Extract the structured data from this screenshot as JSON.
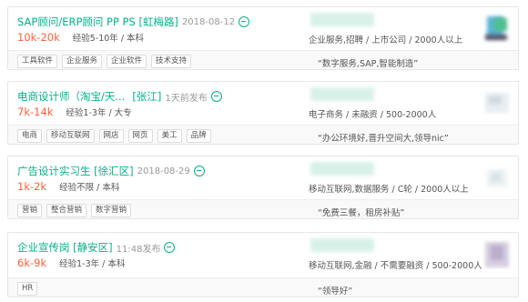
{
  "colors": {
    "accent": "#00b38a",
    "salary": "#fd5f39",
    "muted": "#999999"
  },
  "jobs": [
    {
      "title": "SAP顾问/ERP顾问 PP PS [虹梅路]",
      "time": "2018-08-12",
      "salary": "10k-20k",
      "requirement": "经验5-10年 / 本科",
      "company_info": "企业服务,招聘 / 上市公司 / 2000人以上",
      "tags": [
        "工具软件",
        "企业服务",
        "企业软件",
        "技术支持"
      ],
      "advantage": "“数字服务,SAP,智能制造”",
      "chat_icon": "chat-icon"
    },
    {
      "title": "电商设计师（淘宝/天...",
      "location": "[张江]",
      "time": "1天前发布",
      "salary": "7k-14k",
      "requirement": "经验1-3年 / 大专",
      "company_info": "电子商务 / 未融资 / 500-2000人",
      "tags": [
        "电商",
        "移动互联网",
        "网店",
        "网页",
        "美工",
        "品牌"
      ],
      "advantage": "“办公环境好,晋升空间大,领导nic”",
      "chat_icon": "chat-icon"
    },
    {
      "title": "广告设计实习生 [徐汇区]",
      "time": "2018-08-29",
      "salary": "1k-2k",
      "requirement": "经验不限 / 本科",
      "company_info": "移动互联网,数据服务 / C轮 / 2000人以上",
      "tags": [
        "营销",
        "整合营销",
        "数字营销"
      ],
      "advantage": "“免费三餐，租房补贴”",
      "chat_icon": "chat-icon"
    },
    {
      "title": "企业宣传岗 [静安区]",
      "time": "11:48发布",
      "salary": "6k-9k",
      "requirement": "经验1-3年 / 本科",
      "company_info": "移动互联网,金融 / 不需要融资 / 500-2000人",
      "tags": [
        "HR"
      ],
      "advantage": "“领导好”",
      "chat_icon": "chat-icon"
    }
  ]
}
